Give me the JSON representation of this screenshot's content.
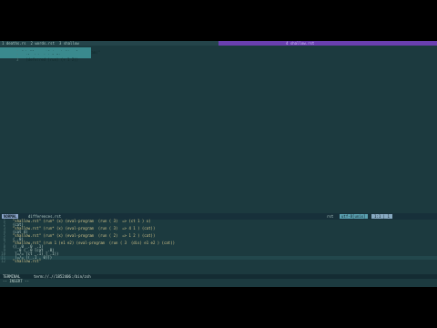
{
  "tabline": {
    "tabs": [
      "1 deaths.rs",
      "2 words.rst",
      "3 shallow"
    ],
    "right_tab": "4 shallow.rst"
  },
  "top_lines": [
    {
      "num": "1",
      "text": "\"shallow.rst\" (run) \"(eval-program)\""
    },
    {
      "num": "2",
      "text": "  (lambda (x) 1 2)"
    },
    {
      "num": "3",
      "text": "  (deferred (run) (+ 1 2))"
    }
  ],
  "status": {
    "mode": "NORMAL",
    "filename": "differences.rst",
    "filetype": "rst",
    "encoding": "utf-8[unix]",
    "position": "1:1 | 1"
  },
  "bottom_lines": [
    {
      "num": "1",
      "text": "  \"shallow.rst\" (run* (x) (eval-program  (run ( 3)  => (ct 1 ) x)"
    },
    {
      "num": "2",
      "text": "  (cat)"
    },
    {
      "num": "3",
      "text": "  \"shallow.rst\" (run* (x) (eval-program  (run ( 3)  => 4 1 ) (cat))"
    },
    {
      "num": "4",
      "text": "  (cat 4)"
    },
    {
      "num": "5",
      "text": "  \"shallow.rst\" (run* (x) (eval-program  (run ( 2)  => 1 2 ) (cat))"
    },
    {
      "num": "6",
      "text": "  (_.0)"
    },
    {
      "num": "7",
      "text": "  \"shallow.rst\" (run 1 (e1 e2) (eval-program  (run ( 3  (dis) e1 e2 ) (cat))"
    },
    {
      "num": "8",
      "text": "  ((_.0 _.0 _.1)"
    },
    {
      "num": "9",
      "text": "   _.0 (_.0 (cat _.0)"
    },
    {
      "num": "10",
      "text": "   (=/= (ct _.1) (_.1))"
    },
    {
      "num": "11",
      "text": "   (=/= ((_.1 . 0)))"
    },
    {
      "num": "12",
      "text": "  \"shallow.rst\""
    }
  ],
  "terminal": {
    "label": "TERMINAL",
    "path": "term://.//1852406:/bin/zsh"
  },
  "cmdline": "-- INSERT --"
}
